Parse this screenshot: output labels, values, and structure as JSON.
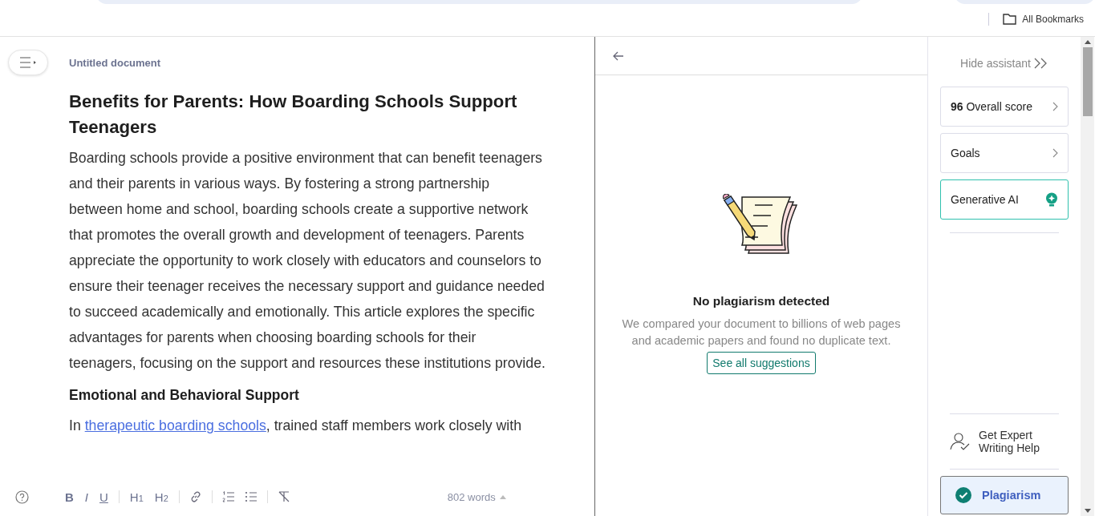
{
  "browser": {
    "bookmarks_label": "All Bookmarks"
  },
  "editor": {
    "doc_title": "Untitled document",
    "heading": "Benefits for Parents: How Boarding Schools Support Teenagers",
    "paragraph": "Boarding schools provide a positive environment that can benefit teenagers and their parents in various ways. By fostering a strong partnership between home and school, boarding schools create a supportive network that promotes the overall growth and development of teenagers. Parents appreciate the opportunity to work closely with educators and counselors to ensure their teenager receives the necessary support and guidance needed to succeed academically and emotionally. This article explores the specific advantages for parents when choosing boarding schools for their teenagers, focusing on the support and resources these institutions provide.",
    "subheading": "Emotional and Behavioral Support",
    "last_line": {
      "before": "In ",
      "link": "therapeutic boarding schools",
      "after": ", trained staff members work closely with"
    }
  },
  "toolbar": {
    "buttons": [
      {
        "kind": "bold",
        "label": "B"
      },
      {
        "kind": "italic",
        "label": "I"
      },
      {
        "kind": "underline",
        "label": "U"
      },
      {
        "kind": "sep"
      },
      {
        "kind": "heading",
        "label": "H",
        "sub": "1"
      },
      {
        "kind": "heading",
        "label": "H",
        "sub": "2"
      },
      {
        "kind": "sep"
      },
      {
        "kind": "link"
      },
      {
        "kind": "sep"
      },
      {
        "kind": "ordered"
      },
      {
        "kind": "bullets"
      },
      {
        "kind": "sep"
      },
      {
        "kind": "clear"
      }
    ],
    "word_count": "802 words"
  },
  "plagiarism_panel": {
    "title": "No plagiarism detected",
    "message": "We compared your document to billions of web pages and academic papers and found no duplicate text.",
    "button": "See all suggestions"
  },
  "assistant": {
    "hide_label": "Hide assistant",
    "cards": [
      {
        "kind": "score",
        "score": "96",
        "label": "Overall score"
      },
      {
        "kind": "nav",
        "label": "Goals"
      },
      {
        "kind": "ai",
        "label": "Generative AI"
      }
    ],
    "expert": "Get Expert Writing Help",
    "plagiarism": {
      "label": "Plagiarism",
      "selected": true
    }
  }
}
